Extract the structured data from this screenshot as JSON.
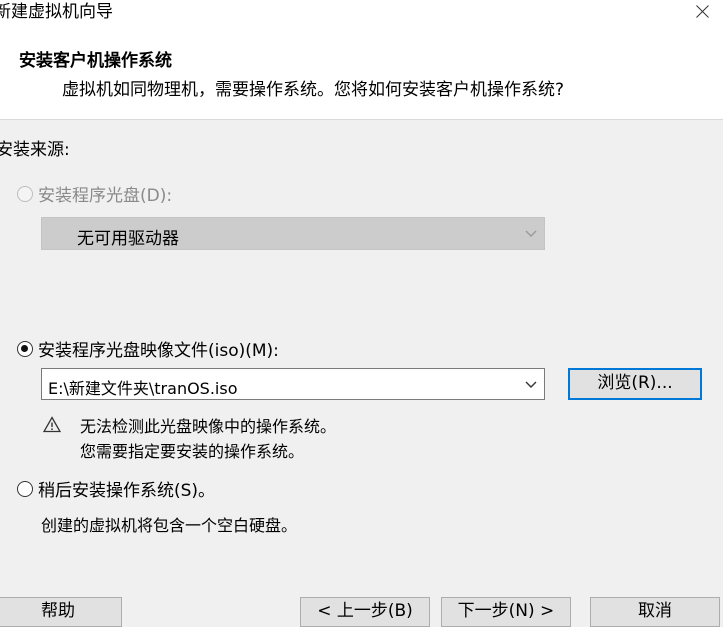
{
  "window": {
    "title": "新建虚拟机向导",
    "close_icon": "close-icon"
  },
  "header": {
    "title": "安装客户机操作系统",
    "description": "虚拟机如同物理机，需要操作系统。您将如何安装客户机操作系统?"
  },
  "source": {
    "label": "安装来源:",
    "options": [
      {
        "label": "安装程序光盘(D):",
        "selected": false,
        "disabled": true
      },
      {
        "label": "安装程序光盘映像文件(iso)(M):",
        "selected": true,
        "disabled": false
      },
      {
        "label": "稍后安装操作系统(S)。",
        "selected": false,
        "disabled": false
      }
    ],
    "disc_combo": {
      "value": "无可用驱动器"
    },
    "iso_combo": {
      "value": "E:\\新建文件夹\\tranOS.iso"
    },
    "browse_label": "浏览(R)...",
    "warning": {
      "icon": "warning-icon",
      "line1": "无法检测此光盘映像中的操作系统。",
      "line2": "您需要指定要安装的操作系统。"
    },
    "later_description": "创建的虚拟机将包含一个空白硬盘。"
  },
  "footer": {
    "help_label": "帮助",
    "back_label": "< 上一步(B)",
    "next_label": "下一步(N) >",
    "cancel_label": "取消"
  }
}
